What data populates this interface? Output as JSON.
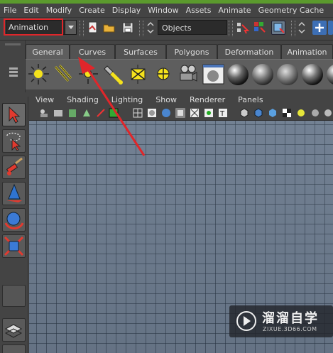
{
  "menu": [
    "File",
    "Edit",
    "Modify",
    "Create",
    "Display",
    "Window",
    "Assets",
    "Animate",
    "Geometry Cache"
  ],
  "status_line": {
    "mode_value": "Animation",
    "selection_mask_value": "Objects"
  },
  "shelf": {
    "tabs": [
      "General",
      "Curves",
      "Surfaces",
      "Polygons",
      "Deformation",
      "Animation"
    ],
    "active_tab": "General"
  },
  "panel": {
    "menus": [
      "View",
      "Shading",
      "Lighting",
      "Show",
      "Renderer",
      "Panels"
    ]
  },
  "watermark": {
    "name": "溜溜自学",
    "url": "ZIXUE.3D66.COM"
  },
  "colors": {
    "annotation": "#e0262a",
    "viewport_background": "#6d7c8f",
    "ui_background": "#444444"
  }
}
